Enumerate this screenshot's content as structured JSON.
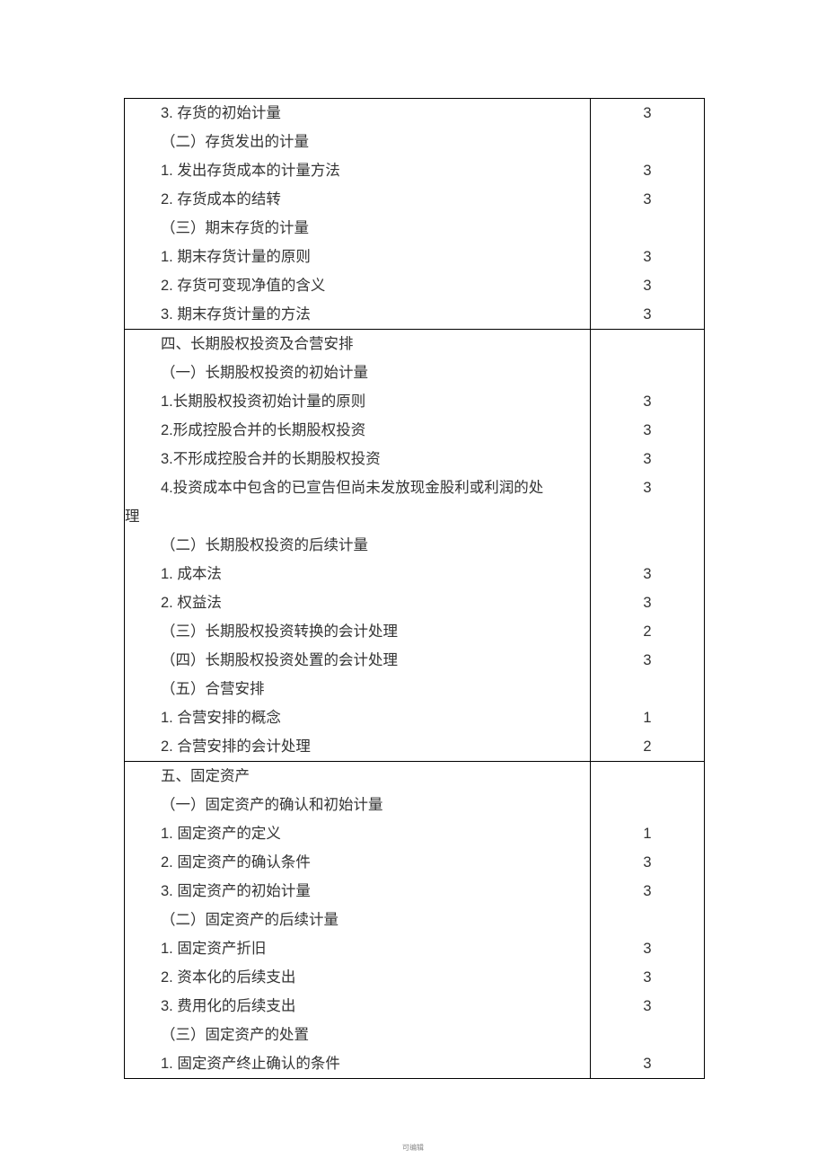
{
  "footer": "可编辑",
  "sections": [
    {
      "lines": [
        {
          "t": "3. 存货的初始计量",
          "cls": "indent1"
        },
        {
          "t": "（二）存货发出的计量",
          "cls": "indent2"
        },
        {
          "t": "1. 发出存货成本的计量方法",
          "cls": "indent1"
        },
        {
          "t": "2. 存货成本的结转",
          "cls": "indent1"
        },
        {
          "t": "（三）期末存货的计量",
          "cls": "indent2"
        },
        {
          "t": "1. 期末存货计量的原则",
          "cls": "indent1"
        },
        {
          "t": "2. 存货可变现净值的含义",
          "cls": "indent1"
        },
        {
          "t": "3. 期末存货计量的方法",
          "cls": "indent1"
        }
      ],
      "vals": [
        "3",
        "",
        "3",
        "3",
        "",
        "3",
        "3",
        "3"
      ]
    },
    {
      "lines": [
        {
          "t": "四、长期股权投资及合营安排",
          "cls": "indent2"
        },
        {
          "t": "（一）长期股权投资的初始计量",
          "cls": "indent2"
        },
        {
          "t": "1.长期股权投资初始计量的原则",
          "cls": "indent1"
        },
        {
          "t": "2.形成控股合并的长期股权投资",
          "cls": "indent1"
        },
        {
          "t": "3.不形成控股合并的长期股权投资",
          "cls": "indent1"
        },
        {
          "t": "4.投资成本中包含的已宣告但尚未发放现金股利或利润的处",
          "cls": "indent1"
        },
        {
          "t": "理",
          "cls": "wrap"
        },
        {
          "t": "（二）长期股权投资的后续计量",
          "cls": "indent2"
        },
        {
          "t": "1. 成本法",
          "cls": "indent1"
        },
        {
          "t": "2. 权益法",
          "cls": "indent1"
        },
        {
          "t": "（三）长期股权投资转换的会计处理",
          "cls": "indent2"
        },
        {
          "t": "（四）长期股权投资处置的会计处理",
          "cls": "indent2"
        },
        {
          "t": "（五）合营安排",
          "cls": "indent2"
        },
        {
          "t": "1. 合营安排的概念",
          "cls": "indent1"
        },
        {
          "t": "2. 合营安排的会计处理",
          "cls": "indent1"
        }
      ],
      "vals": [
        "",
        "",
        "3",
        "3",
        "3",
        "3",
        "",
        "",
        "3",
        "3",
        "2",
        "3",
        "",
        "1",
        "2"
      ]
    },
    {
      "lines": [
        {
          "t": "五、固定资产",
          "cls": "indent2"
        },
        {
          "t": "（一）固定资产的确认和初始计量",
          "cls": "indent2"
        },
        {
          "t": "1. 固定资产的定义",
          "cls": "indent1"
        },
        {
          "t": "2. 固定资产的确认条件",
          "cls": "indent1"
        },
        {
          "t": "3. 固定资产的初始计量",
          "cls": "indent1"
        },
        {
          "t": "（二）固定资产的后续计量",
          "cls": "indent2"
        },
        {
          "t": "1. 固定资产折旧",
          "cls": "indent1"
        },
        {
          "t": "2. 资本化的后续支出",
          "cls": "indent1"
        },
        {
          "t": "3. 费用化的后续支出",
          "cls": "indent1"
        },
        {
          "t": "（三）固定资产的处置",
          "cls": "indent2"
        },
        {
          "t": "1. 固定资产终止确认的条件",
          "cls": "indent1"
        }
      ],
      "vals": [
        "",
        "",
        "1",
        "3",
        "3",
        "",
        "3",
        "3",
        "3",
        "",
        "3"
      ]
    }
  ]
}
